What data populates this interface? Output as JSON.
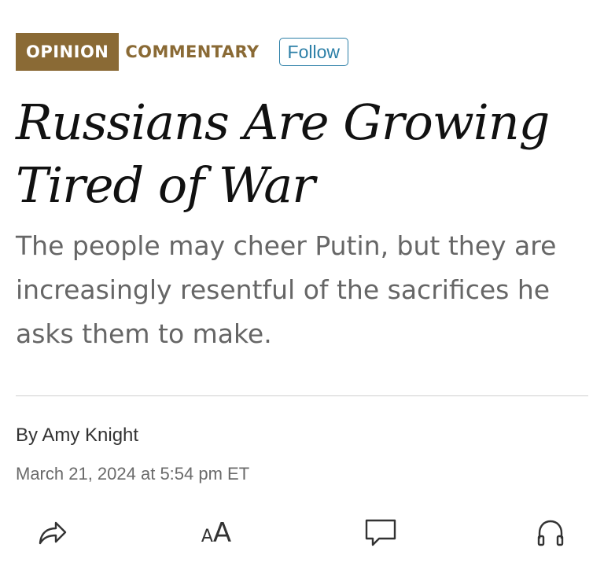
{
  "tags": {
    "badge": "OPINION",
    "section": "COMMENTARY",
    "follow_label": "Follow"
  },
  "article": {
    "headline": "Russians Are Growing Tired of War",
    "dek": "The people may cheer Putin, but they are increasingly resentful of the sacrifices he asks them to make.",
    "byline": "By Amy Knight",
    "timestamp": "March 21, 2024 at 5:54 pm ET"
  },
  "toolbar": {
    "text_size_small": "A",
    "text_size_large": "A",
    "icons": [
      "share-icon",
      "text-size-icon",
      "comment-icon",
      "headphones-icon"
    ]
  },
  "colors": {
    "badge_bg": "#8a6a35",
    "section_text": "#8a6a35",
    "follow_accent": "#2c7fa7",
    "headline": "#111111",
    "dek": "#666666"
  }
}
